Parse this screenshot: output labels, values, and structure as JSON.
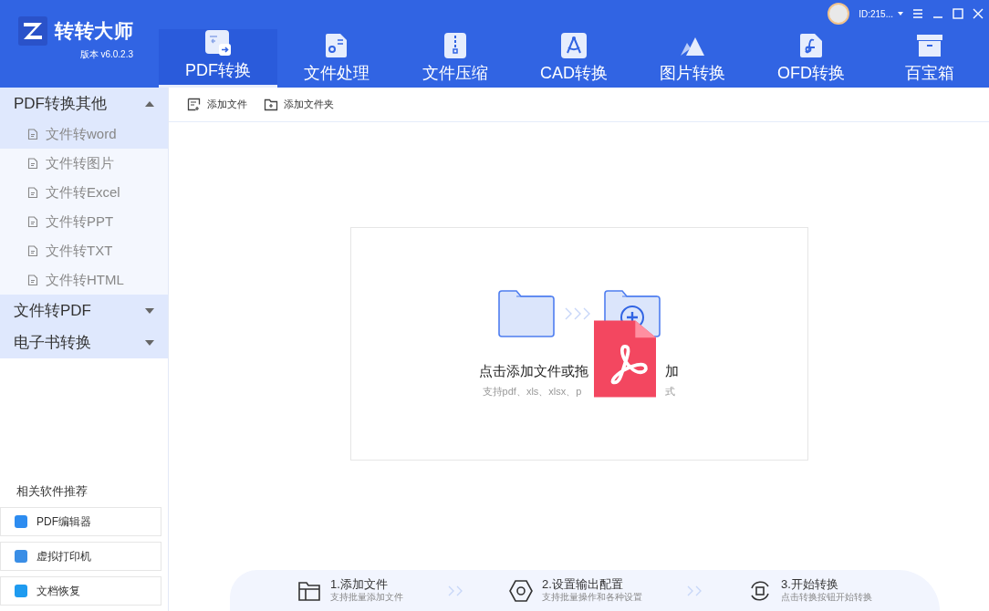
{
  "app": {
    "name": "转转大师",
    "version": "版本 v6.0.2.3"
  },
  "user": {
    "id": "ID:215..."
  },
  "tabs": [
    {
      "label": "PDF转换",
      "selected": true
    },
    {
      "label": "文件处理",
      "selected": false
    },
    {
      "label": "文件压缩",
      "selected": false
    },
    {
      "label": "CAD转换",
      "selected": false
    },
    {
      "label": "图片转换",
      "selected": false
    },
    {
      "label": "OFD转换",
      "selected": false
    },
    {
      "label": "百宝箱",
      "selected": false
    }
  ],
  "sidebar": {
    "groups": [
      {
        "label": "PDF转换其他",
        "expanded": true,
        "children": [
          {
            "label": "文件转word",
            "selected": true
          },
          {
            "label": "文件转图片",
            "selected": false
          },
          {
            "label": "文件转Excel",
            "selected": false
          },
          {
            "label": "文件转PPT",
            "selected": false
          },
          {
            "label": "文件转TXT",
            "selected": false
          },
          {
            "label": "文件转HTML",
            "selected": false
          }
        ]
      },
      {
        "label": "文件转PDF",
        "expanded": false
      },
      {
        "label": "电子书转换",
        "expanded": false
      }
    ],
    "related_title": "相关软件推荐",
    "related": [
      {
        "label": "PDF编辑器",
        "color": "#2d8cf0"
      },
      {
        "label": "虚拟打印机",
        "color": "#3a8ee6"
      },
      {
        "label": "文档恢复",
        "color": "#1e9bf0"
      }
    ]
  },
  "toolbar": [
    "添加文件",
    "添加文件夹"
  ],
  "dropzone": {
    "title_parts": [
      "点击添加文件或拖",
      "加"
    ],
    "hint_parts": [
      "支持pdf、xls、xlsx、p",
      "式"
    ]
  },
  "steps": [
    {
      "title": "1.添加文件",
      "hint": "支持批量添加文件"
    },
    {
      "title": "2.设置输出配置",
      "hint": "支持批量操作和各种设置"
    },
    {
      "title": "3.开始转换",
      "hint": "点击转换按钮开始转换"
    }
  ]
}
